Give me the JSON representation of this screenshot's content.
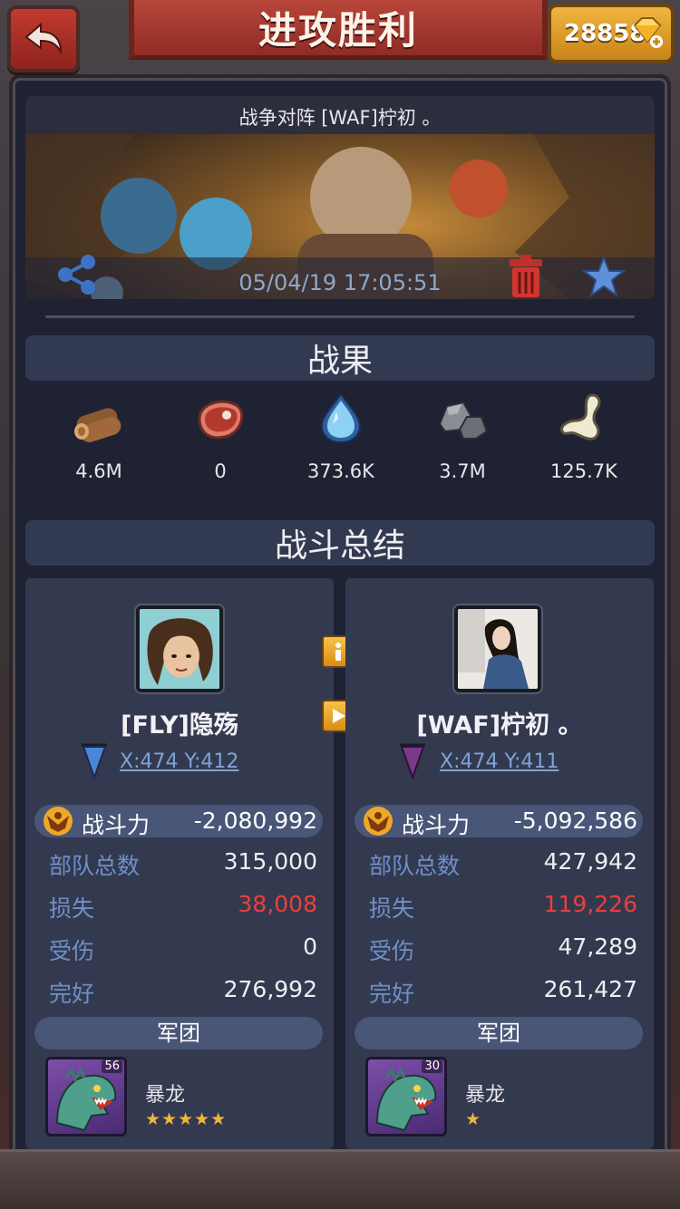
{
  "header": {
    "title": "进攻胜利",
    "gems": "28858"
  },
  "battle": {
    "caption": "战争对阵 [WAF]柠初 。",
    "datetime": "05/04/19 17:05:51"
  },
  "sections": {
    "results": "战果",
    "summary": "战斗总结"
  },
  "loot": [
    {
      "icon": "wood-icon",
      "value": "4.6M"
    },
    {
      "icon": "meat-icon",
      "value": "0"
    },
    {
      "icon": "crystal-icon",
      "value": "373.6K"
    },
    {
      "icon": "stone-icon",
      "value": "3.7M"
    },
    {
      "icon": "bone-icon",
      "value": "125.7K"
    }
  ],
  "attacker": {
    "name": "[FLY]隐殇",
    "coords": "X:474 Y:412",
    "flag_color": "#4a86d6",
    "power_label": "战斗力",
    "power": "-2,080,992",
    "stats": [
      {
        "label": "部队总数",
        "value": "315,000"
      },
      {
        "label": "损失",
        "value": "38,008"
      },
      {
        "label": "受伤",
        "value": "0"
      },
      {
        "label": "完好",
        "value": "276,992"
      }
    ],
    "legion_label": "军团",
    "unit": {
      "name": "暴龙",
      "level": "56",
      "stars": "★★★★★"
    }
  },
  "defender": {
    "name": "[WAF]柠初 。",
    "coords": "X:474 Y:411",
    "flag_color": "#7a3a8c",
    "power_label": "战斗力",
    "power": "-5,092,586",
    "stats": [
      {
        "label": "部队总数",
        "value": "427,942"
      },
      {
        "label": "损失",
        "value": "119,226"
      },
      {
        "label": "受伤",
        "value": "47,289"
      },
      {
        "label": "完好",
        "value": "261,427"
      }
    ],
    "legion_label": "军团",
    "unit": {
      "name": "暴龙",
      "level": "30",
      "stars": "★"
    }
  },
  "colors": {
    "accent_gold": "#f0b640",
    "title_red": "#b8463b",
    "loss_red": "#e8403a",
    "label_blue": "#6f8fc9",
    "link_blue": "#7fa2d6"
  }
}
